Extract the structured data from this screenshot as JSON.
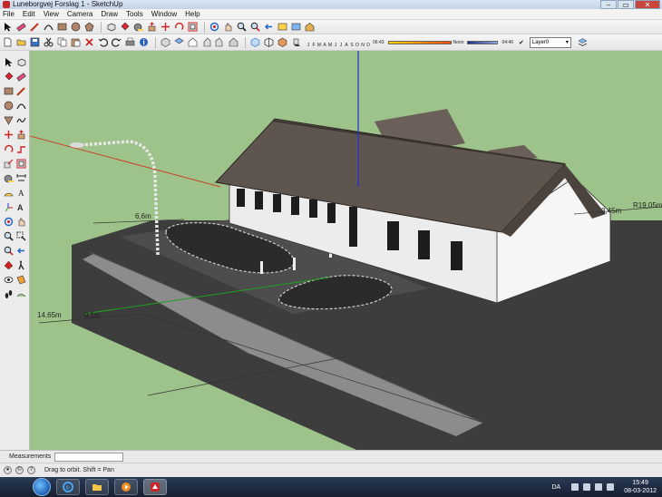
{
  "window": {
    "title": "Luneborgvej Forslag 1 - SketchUp",
    "controls": [
      "–",
      "▭",
      "✕"
    ]
  },
  "menu": [
    "File",
    "Edit",
    "View",
    "Camera",
    "Draw",
    "Tools",
    "Window",
    "Help"
  ],
  "shadow_settings": {
    "months": [
      "J",
      "F",
      "M",
      "A",
      "M",
      "J",
      "J",
      "A",
      "S",
      "O",
      "N",
      "D"
    ],
    "sunrise": "06:43",
    "noon": "Noon",
    "sunset": "04:46"
  },
  "layer": {
    "current": "Layer0"
  },
  "dimensions": {
    "width_label": "6,6m",
    "length_label": "14,65m",
    "small_label": "0,1m",
    "right_label_1": "3,45m",
    "right_label_2": "R19,05m"
  },
  "measurements": {
    "label": "Measurements",
    "value": ""
  },
  "status": {
    "text": "Drag to orbit.  Shift = Pan"
  },
  "taskbar": {
    "language": "DA",
    "time": "15:49",
    "date": "08-03-2012"
  },
  "colors": {
    "ground": "#9ec38a",
    "roof": "#5e554f",
    "wall": "#ececec",
    "pavement": "#3d3d3d",
    "sidewalk": "#8c8c8c",
    "axis_red": "#c8472a",
    "axis_green": "#1ca21c",
    "axis_blue": "#1e2ed6"
  }
}
